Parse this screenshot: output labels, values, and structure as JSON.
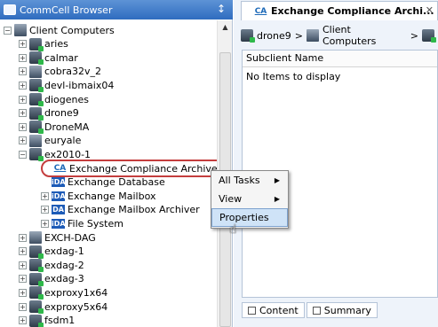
{
  "left_pane": {
    "title": "CommCell Browser",
    "pin_icon": "↕",
    "tree": [
      {
        "label": "Client Computers",
        "expander": "−",
        "icon": "computers",
        "indent": 0
      },
      {
        "label": "aries",
        "expander": "+",
        "icon": "computer",
        "indent": 1
      },
      {
        "label": "calmar",
        "expander": "+",
        "icon": "computer",
        "indent": 1
      },
      {
        "label": "cobra32v_2",
        "expander": "+",
        "icon": "server",
        "indent": 1
      },
      {
        "label": "devl-ibmaix04",
        "expander": "+",
        "icon": "computer",
        "indent": 1
      },
      {
        "label": "diogenes",
        "expander": "+",
        "icon": "computer",
        "indent": 1
      },
      {
        "label": "drone9",
        "expander": "+",
        "icon": "computer",
        "indent": 1
      },
      {
        "label": "DroneMA",
        "expander": "+",
        "icon": "computer",
        "indent": 1
      },
      {
        "label": "euryale",
        "expander": "+",
        "icon": "server",
        "indent": 1
      },
      {
        "label": "ex2010-1",
        "expander": "−",
        "icon": "computer",
        "indent": 1
      },
      {
        "label": "Exchange Compliance Archiver",
        "expander": "",
        "icon": "ca",
        "indent": 2,
        "selected": true
      },
      {
        "label": "Exchange Database",
        "expander": "",
        "icon": "ida",
        "indent": 2
      },
      {
        "label": "Exchange Mailbox",
        "expander": "+",
        "icon": "ida",
        "indent": 2
      },
      {
        "label": "Exchange Mailbox Archiver",
        "expander": "+",
        "icon": "da",
        "indent": 2
      },
      {
        "label": "File System",
        "expander": "+",
        "icon": "ida",
        "indent": 2
      },
      {
        "label": "EXCH-DAG",
        "expander": "+",
        "icon": "cluster",
        "indent": 1
      },
      {
        "label": "exdag-1",
        "expander": "+",
        "icon": "computer",
        "indent": 1
      },
      {
        "label": "exdag-2",
        "expander": "+",
        "icon": "computer",
        "indent": 1
      },
      {
        "label": "exdag-3",
        "expander": "+",
        "icon": "computer",
        "indent": 1
      },
      {
        "label": "exproxy1x64",
        "expander": "+",
        "icon": "computer",
        "indent": 1
      },
      {
        "label": "exproxy5x64",
        "expander": "+",
        "icon": "computer",
        "indent": 1
      },
      {
        "label": "fsdm1",
        "expander": "+",
        "icon": "computer",
        "indent": 1
      }
    ]
  },
  "right_pane": {
    "tab_label": "Exchange Compliance Archi...",
    "tab_icon_text": "CA",
    "breadcrumb": [
      "drone9",
      ">",
      "Client Computers",
      ">"
    ],
    "grid_header": "Subclient Name",
    "grid_empty": "No Items to display",
    "bottom_tabs": [
      "Content",
      "Summary"
    ]
  },
  "context_menu": {
    "items": [
      {
        "label": "All Tasks",
        "submenu": true
      },
      {
        "label": "View",
        "submenu": true
      },
      {
        "label": "Properties",
        "submenu": false,
        "highlighted": true
      }
    ]
  },
  "colors": {
    "header_blue": "#2f6cbf",
    "selection_ring": "#c43d3d",
    "menu_highlight": "#cfe3f7"
  }
}
